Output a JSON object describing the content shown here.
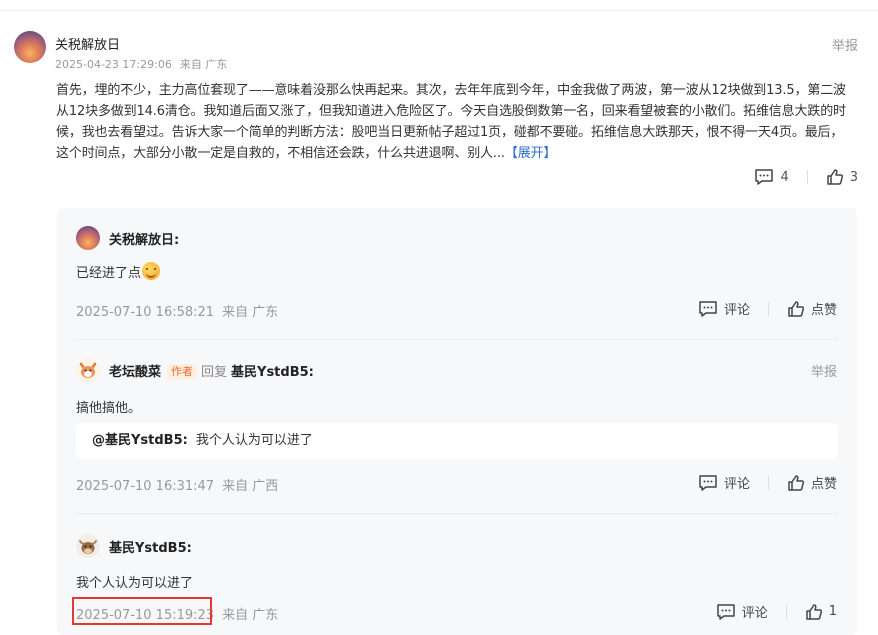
{
  "post": {
    "user_name": "关税解放日",
    "date": "2025-04-23 17:29:06",
    "location": "来自 广东",
    "report_label": "举报",
    "body": "首先，埋的不少，主力高位套现了——意味着没那么快再起来。其次，去年年底到今年，中金我做了两波，第一波从12块做到13.5，第二波从12块多做到14.6清仓。我知道后面又涨了，但我知道进入危险区了。今天自选股倒数第一名，回来看望被套的小散们。拓维信息大跌的时候，我也去看望过。告诉大家一个简单的判断方法：股吧当日更新帖子超过1页，碰都不要碰。拓维信息大跌那天，恨不得一天4页。最后，这个时间点，大部分小散一定是自救的，不相信还会跌，什么共进退啊、别人...",
    "expand_label": "【展开】",
    "comment_count": "4",
    "like_count": "3"
  },
  "replies": [
    {
      "user_name": "关税解放日:",
      "text": "已经进了点",
      "time": "2025-07-10 16:58:21",
      "location": "来自 广东",
      "comment_label": "评论",
      "like_label": "点赞"
    },
    {
      "user_name": "老坛酸菜",
      "author_tag": "作者",
      "reply_word": "回复",
      "reply_to": "基民YstdB5:",
      "report_label": "举报",
      "text": "搞他搞他。",
      "quote_user": "@基民YstdB5:",
      "quote_text": "我个人认为可以进了",
      "time": "2025-07-10 16:31:47",
      "location": "来自 广西",
      "comment_label": "评论",
      "like_label": "点赞"
    },
    {
      "user_name": "基民YstdB5:",
      "text": "我个人认为可以进了",
      "time": "2025-07-10 15:19:23",
      "location": "来自 广东",
      "comment_label": "评论",
      "like_count": "1"
    }
  ],
  "colors": {
    "link_blue": "#2f6dd0",
    "author_tag": "#f06a2b",
    "highlight_box": "#e53935"
  }
}
